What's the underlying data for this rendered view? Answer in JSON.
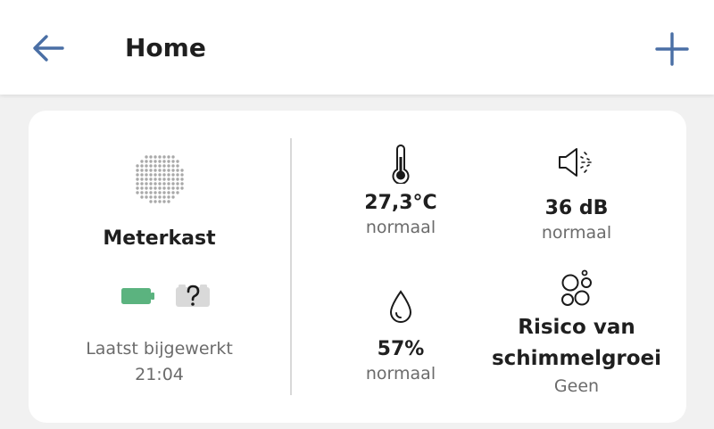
{
  "header": {
    "title": "Home",
    "back_icon": "arrow-left-icon",
    "add_icon": "plus-icon",
    "accent_color": "#4a6fa5"
  },
  "device": {
    "name": "Meterkast",
    "icon": "speaker-grille-icon",
    "battery_icon": "battery-full-icon",
    "battery_color": "#5bb37f",
    "status_icon": "unknown-status-icon",
    "updated_label": "Laatst bijgewerkt",
    "updated_time": "21:04"
  },
  "metrics": {
    "temperature": {
      "icon": "thermometer-icon",
      "value": "27,3°C",
      "status": "normaal"
    },
    "sound": {
      "icon": "speaker-volume-icon",
      "value": "36 dB",
      "status": "normaal"
    },
    "humidity": {
      "icon": "water-drop-icon",
      "value": "57%",
      "status": "normaal"
    },
    "mold": {
      "icon": "mold-bubbles-icon",
      "line1": "Risico van",
      "line2": "schimmelgroei",
      "status": "Geen"
    }
  }
}
